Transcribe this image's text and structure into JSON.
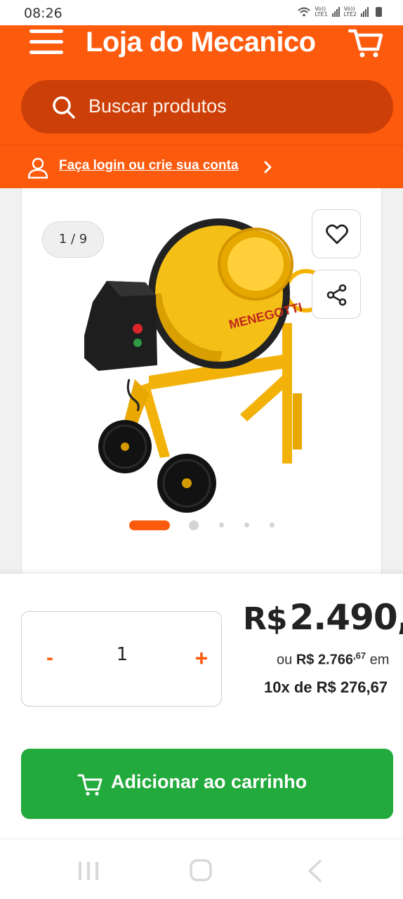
{
  "status_bar": {
    "time": "08:26",
    "sim1": "LTE1",
    "sim2": "LTE2"
  },
  "header": {
    "menu_icon": "hamburger-menu-icon",
    "logo_text": "Loja do Mecanico",
    "cart_icon": "shopping-cart-icon",
    "search": {
      "placeholder": "Buscar produtos",
      "icon": "search-icon"
    },
    "login": {
      "icon": "user-icon",
      "text": "Faça login ou crie sua conta",
      "chevron": "chevron-right-icon"
    }
  },
  "product": {
    "image_counter": "1 / 9",
    "image_brand_text": "MENEGOTTI",
    "favorite_icon": "heart-icon",
    "share_icon": "share-icon",
    "carousel": {
      "total_dots": 5,
      "active_index": 0
    }
  },
  "purchase": {
    "quantity": {
      "minus": "-",
      "value": "1",
      "plus": "+"
    },
    "price": {
      "currency": "R$",
      "value": "2.490,",
      "alt_prefix": "ou",
      "alt_price": "R$ 2.766",
      "alt_cents": ",67",
      "alt_suffix": "em",
      "installments": "10x de R$ 276,67"
    },
    "add_to_cart": {
      "label": "Adicionar ao carrinho",
      "icon": "cart-icon"
    }
  },
  "nav_bar": {
    "recents_icon": "recents-icon",
    "home_icon": "home-icon",
    "back_icon": "back-icon"
  },
  "colors": {
    "brand_orange": "#fc5a0d",
    "search_bg": "#cc3f08",
    "button_green": "#22aa3c"
  }
}
